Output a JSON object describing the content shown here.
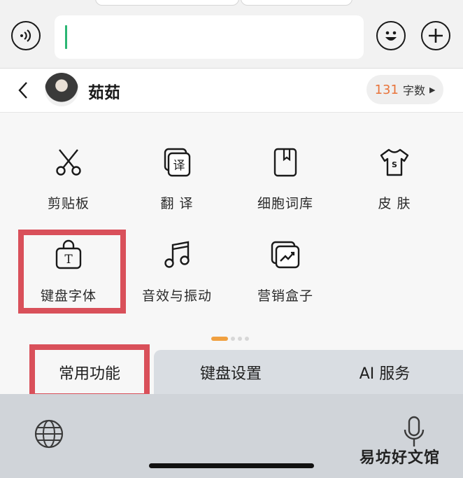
{
  "contact": {
    "name": "茹茹",
    "wordcount_number": "131",
    "wordcount_label": "字数"
  },
  "grid": [
    {
      "label": "剪贴板",
      "icon": "scissors-icon"
    },
    {
      "label": "翻 译",
      "icon": "translate-icon"
    },
    {
      "label": "细胞词库",
      "icon": "dictionary-icon"
    },
    {
      "label": "皮 肤",
      "icon": "tshirt-icon"
    },
    {
      "label": "键盘字体",
      "icon": "font-bag-icon"
    },
    {
      "label": "音效与振动",
      "icon": "music-note-icon"
    },
    {
      "label": "营销盒子",
      "icon": "marketing-box-icon"
    }
  ],
  "tabs": [
    {
      "label": "常用功能",
      "active": true
    },
    {
      "label": "键盘设置",
      "active": false
    },
    {
      "label": "AI 服务",
      "active": false
    }
  ],
  "watermark": "易坊好文馆",
  "colors": {
    "highlight": "#d9505a",
    "accent_orange": "#e8743b",
    "caret_green": "#2bb673"
  }
}
